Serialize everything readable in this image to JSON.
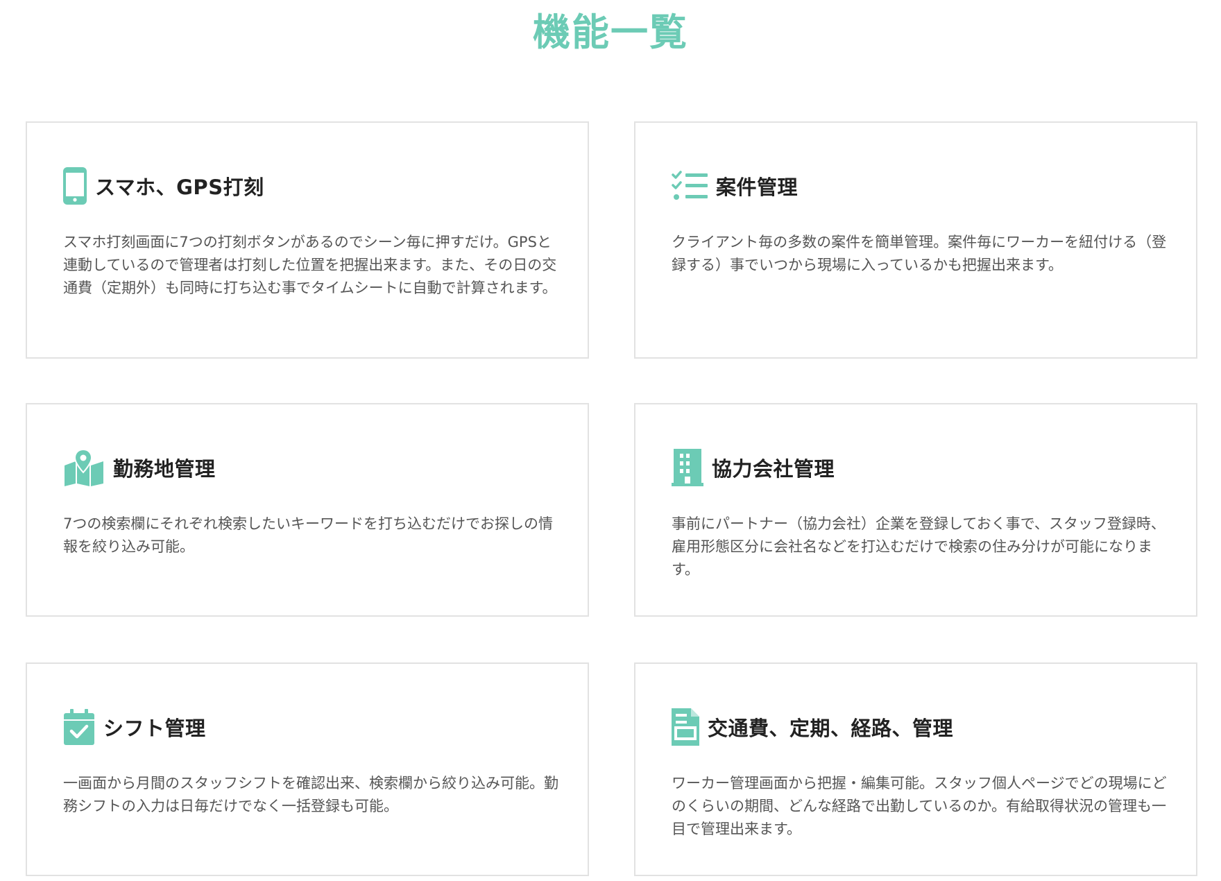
{
  "page": {
    "title": "機能一覧"
  },
  "colors": {
    "accent": "#6ccbb5",
    "card_border": "#e2e2e2",
    "title_text": "#222222",
    "body_text": "#555555"
  },
  "features": [
    {
      "icon": "smartphone-icon",
      "title": "スマホ、GPS打刻",
      "description": "スマホ打刻画面に7つの打刻ボタンがあるのでシーン毎に押すだけ。GPSと連動しているので管理者は打刻した位置を把握出来ます。また、その日の交通費（定期外）も同時に打ち込む事でタイムシートに自動で計算されます。"
    },
    {
      "icon": "checklist-icon",
      "title": "案件管理",
      "description": "クライアント毎の多数の案件を簡単管理。案件毎にワーカーを紐付ける（登録する）事でいつから現場に入っているかも把握出来ます。"
    },
    {
      "icon": "map-pin-icon",
      "title": "勤務地管理",
      "description": "7つの検索欄にそれぞれ検索したいキーワードを打ち込むだけでお探しの情報を絞り込み可能。"
    },
    {
      "icon": "building-icon",
      "title": "協力会社管理",
      "description": "事前にパートナー（協力会社）企業を登録しておく事で、スタッフ登録時、雇用形態区分に会社名などを打込むだけで検索の住み分けが可能になります。"
    },
    {
      "icon": "calendar-check-icon",
      "title": "シフト管理",
      "description": "一画面から月間のスタッフシフトを確認出来、検索欄から絞り込み可能。勤務シフトの入力は日毎だけでなく一括登録も可能。"
    },
    {
      "icon": "document-icon",
      "title": "交通費、定期、経路、管理",
      "description": "ワーカー管理画面から把握・編集可能。スタッフ個人ページでどの現場にどのくらいの期間、どんな経路で出勤しているのか。有給取得状況の管理も一目で管理出来ます。"
    }
  ]
}
